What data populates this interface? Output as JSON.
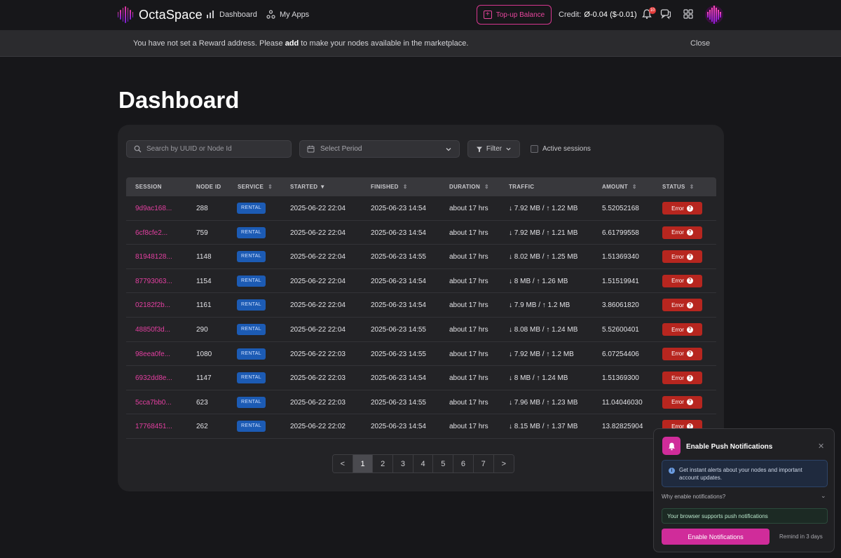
{
  "nav": {
    "brand": "OctaSpace",
    "dashboard_label": "Dashboard",
    "myapps_label": "My Apps",
    "topup_label": "Top-up Balance",
    "credit_label": "Credit:",
    "credit_value": "Ø-0.04 ($-0.01)",
    "notification_count": "10",
    "icons": [
      "chart-bar-icon",
      "apps-icon",
      "plus-square-icon",
      "bell-icon",
      "chat-icon",
      "grid-icon"
    ]
  },
  "banner": {
    "text_before": "You have not set a Reward address. Please ",
    "text_bold": "add",
    "text_after": " to make your nodes available in the marketplace.",
    "close_label": "Close"
  },
  "page": {
    "title": "Dashboard"
  },
  "toolbar": {
    "search_placeholder": "Search by UUID or Node Id",
    "period_placeholder": "Select Period",
    "filter_label": "Filter",
    "active_sessions_label": "Active sessions"
  },
  "table": {
    "headers": {
      "session": "SESSION",
      "node_id": "NODE ID",
      "service": "SERVICE",
      "started": "STARTED",
      "finished": "FINISHED",
      "duration": "DURATION",
      "traffic": "TRAFFIC",
      "amount": "AMOUNT",
      "status": "STATUS"
    },
    "sort_glyph": "⇕",
    "sorted_glyph": "▼",
    "rows": [
      {
        "session": "9d9ac168...",
        "node_id": "288",
        "service": "RENTAL",
        "started": "2025-06-22 22:04",
        "finished": "2025-06-23 14:54",
        "duration": "about 17 hrs",
        "traffic": "↓ 7.92 MB / ↑ 1.22 MB",
        "amount": "5.52052168",
        "status": "Error"
      },
      {
        "session": "6cf8cfe2...",
        "node_id": "759",
        "service": "RENTAL",
        "started": "2025-06-22 22:04",
        "finished": "2025-06-23 14:54",
        "duration": "about 17 hrs",
        "traffic": "↓ 7.92 MB / ↑ 1.21 MB",
        "amount": "6.61799558",
        "status": "Error"
      },
      {
        "session": "81948128...",
        "node_id": "1148",
        "service": "RENTAL",
        "started": "2025-06-22 22:04",
        "finished": "2025-06-23 14:55",
        "duration": "about 17 hrs",
        "traffic": "↓ 8.02 MB / ↑ 1.25 MB",
        "amount": "1.51369340",
        "status": "Error"
      },
      {
        "session": "87793063...",
        "node_id": "1154",
        "service": "RENTAL",
        "started": "2025-06-22 22:04",
        "finished": "2025-06-23 14:54",
        "duration": "about 17 hrs",
        "traffic": "↓ 8 MB / ↑ 1.26 MB",
        "amount": "1.51519941",
        "status": "Error"
      },
      {
        "session": "02182f2b...",
        "node_id": "1161",
        "service": "RENTAL",
        "started": "2025-06-22 22:04",
        "finished": "2025-06-23 14:54",
        "duration": "about 17 hrs",
        "traffic": "↓ 7.9 MB / ↑ 1.2 MB",
        "amount": "3.86061820",
        "status": "Error"
      },
      {
        "session": "48850f3d...",
        "node_id": "290",
        "service": "RENTAL",
        "started": "2025-06-22 22:04",
        "finished": "2025-06-23 14:55",
        "duration": "about 17 hrs",
        "traffic": "↓ 8.08 MB / ↑ 1.24 MB",
        "amount": "5.52600401",
        "status": "Error"
      },
      {
        "session": "98eea0fe...",
        "node_id": "1080",
        "service": "RENTAL",
        "started": "2025-06-22 22:03",
        "finished": "2025-06-23 14:55",
        "duration": "about 17 hrs",
        "traffic": "↓ 7.92 MB / ↑ 1.2 MB",
        "amount": "6.07254406",
        "status": "Error"
      },
      {
        "session": "6932dd8e...",
        "node_id": "1147",
        "service": "RENTAL",
        "started": "2025-06-22 22:03",
        "finished": "2025-06-23 14:54",
        "duration": "about 17 hrs",
        "traffic": "↓ 8 MB / ↑ 1.24 MB",
        "amount": "1.51369300",
        "status": "Error"
      },
      {
        "session": "5cca7bb0...",
        "node_id": "623",
        "service": "RENTAL",
        "started": "2025-06-22 22:03",
        "finished": "2025-06-23 14:55",
        "duration": "about 17 hrs",
        "traffic": "↓ 7.96 MB / ↑ 1.23 MB",
        "amount": "11.04046030",
        "status": "Error"
      },
      {
        "session": "17768451...",
        "node_id": "262",
        "service": "RENTAL",
        "started": "2025-06-22 22:02",
        "finished": "2025-06-23 14:54",
        "duration": "about 17 hrs",
        "traffic": "↓ 8.15 MB / ↑ 1.37 MB",
        "amount": "13.82825904",
        "status": "Error"
      }
    ]
  },
  "pagination": {
    "prev": "<",
    "next": ">",
    "pages": [
      "1",
      "2",
      "3",
      "4",
      "5",
      "6",
      "7"
    ],
    "current": "1"
  },
  "push": {
    "title": "Enable Push Notifications",
    "info": "Get instant alerts about your nodes and important account updates.",
    "why": "Why enable notifications?",
    "supported": "Your browser supports push notifications",
    "enable_label": "Enable Notifications",
    "later_label": "Remind in 3 days"
  },
  "colors": {
    "accent": "#d02c9a",
    "link": "#e23fa0",
    "error": "#b7261f",
    "rental": "#1c5bb4",
    "background": "#17171a",
    "card": "#232326"
  }
}
